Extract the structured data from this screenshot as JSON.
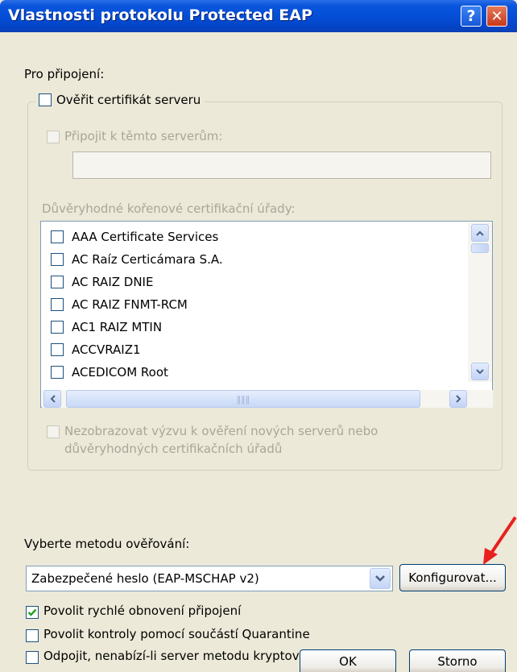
{
  "title": "Vlastnosti protokolu Protected EAP",
  "titlebar": {
    "help_glyph": "?",
    "close_glyph": "✕"
  },
  "connection_label": "Pro připojení:",
  "verify_cert": {
    "label": "Ověřit certifikát serveru",
    "checked": false
  },
  "connect_servers": {
    "label": "Připojit k těmto serverům:",
    "checked": false,
    "value": ""
  },
  "trusted_ca_label": "Důvěryhodné kořenové certifikační úřady:",
  "ca_list": [
    "AAA Certificate Services",
    "AC Raíz Certicámara S.A.",
    "AC RAIZ DNIE",
    "AC RAIZ FNMT-RCM",
    "AC1 RAIZ MTIN",
    "ACCVRAIZ1",
    "ACEDICOM Root"
  ],
  "no_prompt": {
    "line1": "Nezobrazovat výzvu k ověření nových serverů nebo",
    "line2": "důvěryhodných certifikačních úřadů",
    "checked": false
  },
  "auth_method_label": "Vyberte metodu ověřování:",
  "auth_method_value": "Zabezpečené heslo (EAP-MSCHAP v2)",
  "configure_button": "Konfigurovat...",
  "options": {
    "fast_reconnect": {
      "label": "Povolit rychlé obnovení připojení",
      "checked": true
    },
    "quarantine": {
      "label": "Povolit kontroly pomocí součástí Quarantine",
      "checked": false
    },
    "tlv": {
      "label": "Odpojit, nenabízí-li server metodu kryptovazeb TLV",
      "checked": false
    }
  },
  "ok_button": "OK",
  "cancel_button": "Storno",
  "colors": {
    "titlebar": "#0450d8",
    "dialog_bg": "#ece9d8",
    "check": "#21a121",
    "annotation_arrow": "#e8201f"
  }
}
